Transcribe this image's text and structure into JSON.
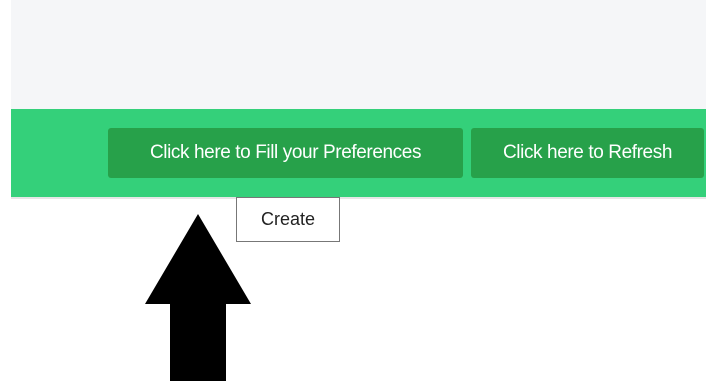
{
  "toolbar": {
    "preferences_button_label": "Click here to Fill your Preferences",
    "refresh_button_label": "Click here to Refresh"
  },
  "tooltip": {
    "text": "Create"
  },
  "colors": {
    "toolbar_background": "#34d07a",
    "button_background": "#27a14a",
    "header_background": "#f5f6f8",
    "annotation_arrow": "#000000"
  },
  "annotation": {
    "arrow_direction": "up"
  }
}
